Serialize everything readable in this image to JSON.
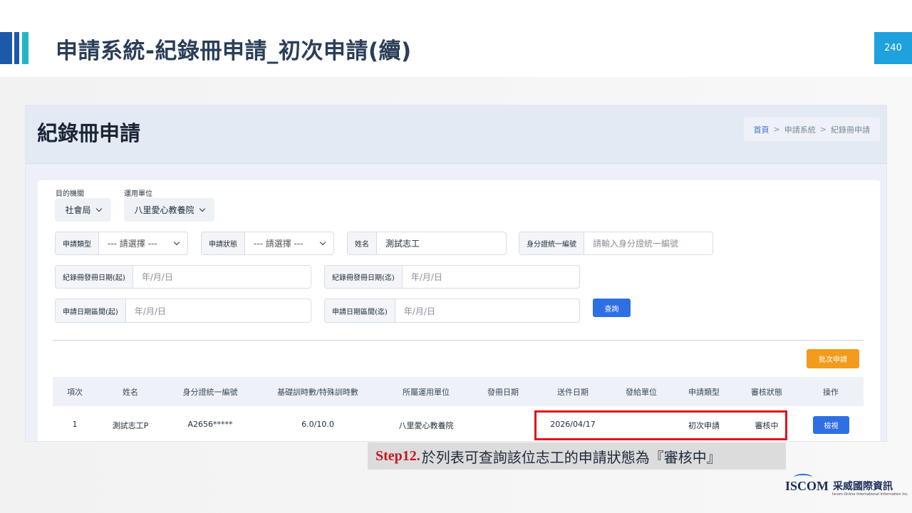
{
  "slide": {
    "title": "申請系統-紀錄冊申請_初次申請(續)",
    "page_number": "240"
  },
  "app": {
    "page_title": "紀錄冊申請",
    "breadcrumb": [
      "首頁",
      "申請系統",
      "紀錄冊申請"
    ],
    "breadcrumb_sep": ">"
  },
  "filters": {
    "target_org_label": "目的機關",
    "target_org_value": "社會局",
    "unit_label": "運用單位",
    "unit_value": "八里愛心教養院",
    "apply_type_label": "申請類型",
    "apply_type_value": "--- 請選擇 ---",
    "status_label": "申請狀態",
    "status_value": "--- 請選擇 ---",
    "name_label": "姓名",
    "name_value": "測試志工",
    "id_label": "身分證統一編號",
    "id_placeholder": "請輸入身分證統一編號",
    "issue_date_start_label": "紀錄冊發冊日期(起)",
    "issue_date_end_label": "紀錄冊發冊日期(迄)",
    "apply_date_start_label": "申請日期區間(起)",
    "apply_date_end_label": "申請日期區間(迄)",
    "date_placeholder": "年/月/日",
    "query_button": "查詢"
  },
  "batch_button": "批次申請",
  "table": {
    "headers": [
      "項次",
      "姓名",
      "身分證統一編號",
      "基礎訓時數/特殊訓時數",
      "所屬運用單位",
      "發冊日期",
      "送件日期",
      "發給單位",
      "申請類型",
      "審核狀態",
      "操作"
    ],
    "rows": [
      {
        "index": "1",
        "name": "測試志工P",
        "id": "A2656*****",
        "hours": "6.0/10.0",
        "unit": "八里愛心教養院",
        "issue_date": "",
        "submit_date": "2026/04/17",
        "issuer": "",
        "apply_type": "初次申請",
        "status": "審核中",
        "action": "檢視"
      }
    ]
  },
  "caption": {
    "step": "Step12.",
    "text": "於列表可查詢該位志工的申請狀態為『審核中』"
  },
  "logo": {
    "en": "ISCOM",
    "zh": "采威國際資訊",
    "sub": "Iscom Online International Information Inc."
  },
  "colors": {
    "accent_blue": "#2f6fe4",
    "page_number_bg": "#1ea1dc",
    "batch_orange": "#f39b1c",
    "highlight_red": "#e0141b",
    "step_red": "#c8161d"
  }
}
